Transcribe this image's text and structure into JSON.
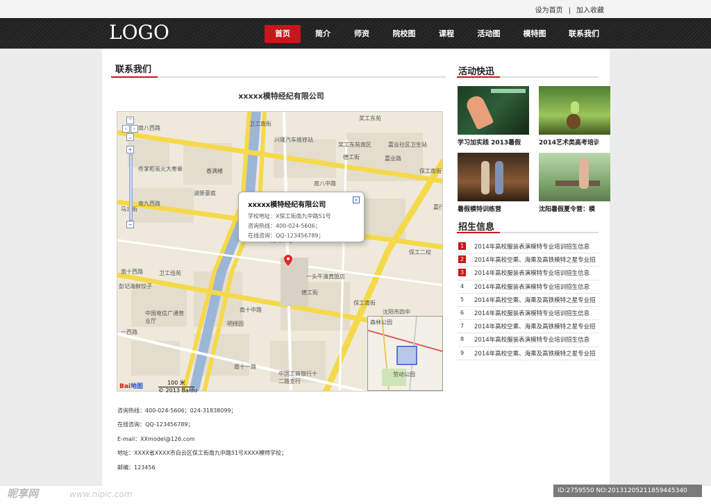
{
  "top_links": {
    "home": "设为首页",
    "sep": "|",
    "fav": "加入收藏"
  },
  "logo": "LOGO",
  "nav": [
    "首页",
    "简介",
    "师资",
    "院校图",
    "课程",
    "活动图",
    "模特图",
    "联系我们"
  ],
  "main": {
    "section_title": "联系我们",
    "company_title": "xxxxx模特经纪有限公司",
    "map": {
      "popup_title": "xxxxx模特经纪有限公司",
      "popup_lines": [
        "学校地址：X保工街南九中路51号",
        "咨询热线：400-024-5606；",
        "在线咨询：QQ-123456789；"
      ],
      "popup_close": "×",
      "labels": [
        "南八西路",
        "卫工南街",
        "兴隆汽车维修站",
        "奖工东苑",
        "奖工东苑南区",
        "嘉业社区卫生站",
        "嘉业路",
        "德工街",
        "佟掌柜炭火大枣串",
        "香满楼",
        "湖景豪庭",
        "南八中路",
        "保工南街",
        "南九西路",
        "嘉行",
        "马北街",
        "南九中路",
        "保工二校",
        "南十西路",
        "卫工佳苑",
        "彭记海鲜饺子",
        "一头牛清真饭店",
        "德工街",
        "中国电信广通营业厅",
        "南十中路",
        "沈阳市四中",
        "明择园",
        "保工南街",
        "一西路",
        "南十一路",
        "中国工商银行十二路支行",
        "森林公园",
        "劳动公园"
      ],
      "scale": "100 米",
      "baidu": "Bai",
      "baidu_map": "地图",
      "copyright": "© 2013 Baidu",
      "zoom_in": "+",
      "zoom_out": "−"
    },
    "info": [
      "咨询热线：400-024-5606；024-31838099；",
      "在线咨询：QQ-123456789；",
      "E-mail：XXmodel@126.com",
      "地址：XXXX省XXXX市白云区保工街南九中路51号XXXX模特学校；",
      "邮编：123456"
    ]
  },
  "sidebar": {
    "news_title": "活动快迅",
    "news": [
      {
        "caption": "学习加实践 2013暑假"
      },
      {
        "caption": "2014艺术类高考培训"
      },
      {
        "caption": "暑假模特训练营"
      },
      {
        "caption": "沈阳暑假夏令营：模"
      }
    ],
    "recruit_title": "招生信息",
    "recruit": [
      {
        "num": "1",
        "text": "2014年高校服装表演模特专业培训招生信息"
      },
      {
        "num": "2",
        "text": "2014年高校空乘、海乘及高铁模特之星专业招"
      },
      {
        "num": "3",
        "text": "2014年高校服装表演模特专业培训招生信息"
      },
      {
        "num": "4",
        "text": "2014年高校服装表演模特专业培训招生信息"
      },
      {
        "num": "5",
        "text": "2014年高校空乘、海乘及高铁模特之星专业招"
      },
      {
        "num": "6",
        "text": "2014年高校服装表演模特专业培训招生信息"
      },
      {
        "num": "7",
        "text": "2014年高校空乘、海乘及高铁模特之星专业招"
      },
      {
        "num": "8",
        "text": "2014年高校服装表演模特专业培训招生信息"
      },
      {
        "num": "9",
        "text": "2014年高校空乘、海乘及高铁模特之星专业招"
      }
    ]
  },
  "watermark": {
    "left": "昵享网",
    "url": "www.nipic.com",
    "id": "ID:2759550 NO:20131205211859445340"
  },
  "colors": {
    "accent": "#c8161d",
    "nav_bg": "#232323",
    "road_yellow": "#f5d94a",
    "canal_blue": "#9cb6d8"
  }
}
